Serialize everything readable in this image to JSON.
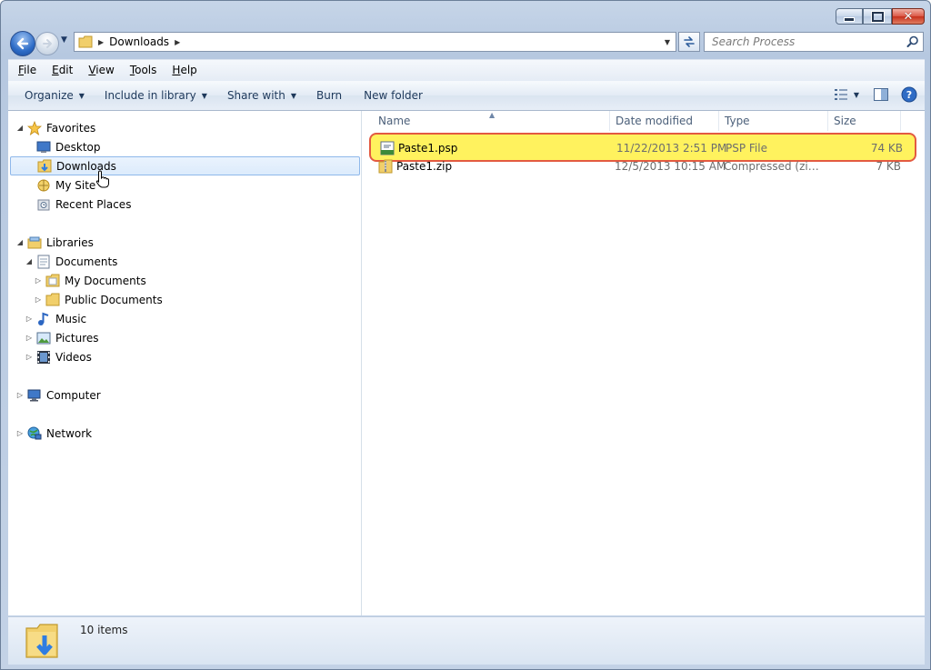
{
  "window": {
    "minimize_label": "Minimize",
    "maximize_label": "Maximize",
    "close_label": "Close"
  },
  "address": {
    "crumbs": [
      "Downloads"
    ]
  },
  "search": {
    "placeholder": "Search Process"
  },
  "menu": {
    "items": [
      {
        "underline": "F",
        "rest": "ile"
      },
      {
        "underline": "E",
        "rest": "dit"
      },
      {
        "underline": "V",
        "rest": "iew"
      },
      {
        "underline": "T",
        "rest": "ools"
      },
      {
        "underline": "H",
        "rest": "elp"
      }
    ]
  },
  "commands": {
    "organize": "Organize",
    "include_in_library": "Include in library",
    "share_with": "Share with",
    "burn": "Burn",
    "new_folder": "New folder"
  },
  "nav_tree": {
    "favorites": "Favorites",
    "desktop": "Desktop",
    "downloads": "Downloads",
    "my_site": "My Site",
    "recent_places": "Recent Places",
    "libraries": "Libraries",
    "documents": "Documents",
    "my_documents": "My Documents",
    "public_documents": "Public Documents",
    "music": "Music",
    "pictures": "Pictures",
    "videos": "Videos",
    "computer": "Computer",
    "network": "Network"
  },
  "columns": {
    "name": "Name",
    "date_modified": "Date modified",
    "type": "Type",
    "size": "Size"
  },
  "files": [
    {
      "name": "Paste1.psp",
      "date": "11/22/2013 2:51 PM",
      "type": "PSP File",
      "size": "74 KB"
    },
    {
      "name": "Paste1.zip",
      "date": "12/5/2013 10:15 AM",
      "type": "Compressed (zipp...",
      "size": "7 KB"
    }
  ],
  "status": {
    "item_count": "10 items"
  },
  "colors": {
    "highlight_fill": "#fff25e",
    "highlight_border": "#e35a41",
    "selection_border": "#8fb8ea"
  }
}
